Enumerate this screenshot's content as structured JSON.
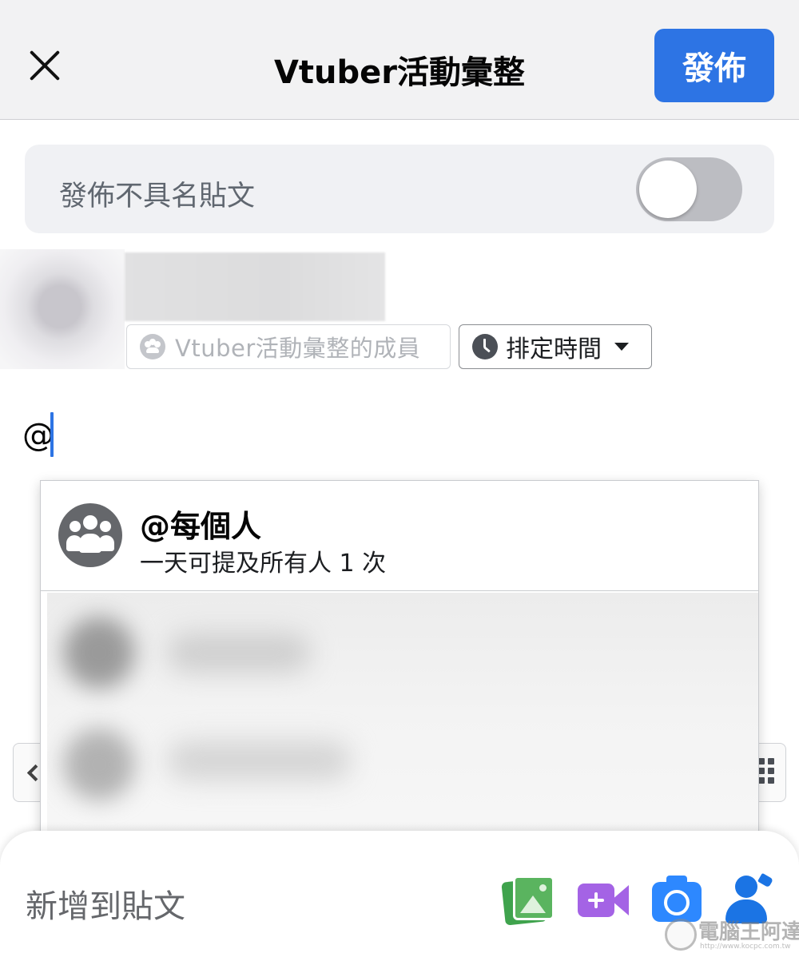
{
  "header": {
    "title": "Vtuber活動彙整",
    "publish_label": "發佈"
  },
  "anonymous": {
    "label": "發佈不具名貼文",
    "toggle_on": false
  },
  "chips": {
    "audience_label": "Vtuber活動彙整的成員",
    "schedule_label": "排定時間"
  },
  "editor": {
    "text": "@"
  },
  "mention_popup": {
    "everyone_name": "@每個人",
    "everyone_sub": "一天可提及所有人 1 次"
  },
  "bottom_bar": {
    "add_to_post_label": "新增到貼文",
    "tools": [
      "photo-icon",
      "live-video-icon",
      "camera-icon",
      "tag-people-icon"
    ]
  },
  "watermark": {
    "brand": "電腦王阿達",
    "url": "http://www.kocpc.com.tw"
  },
  "colors": {
    "accent": "#2d74e4",
    "photo": "#5ab45f",
    "live": "#a463e5",
    "camera": "#2d88ff",
    "tag": "#1b74e4"
  }
}
